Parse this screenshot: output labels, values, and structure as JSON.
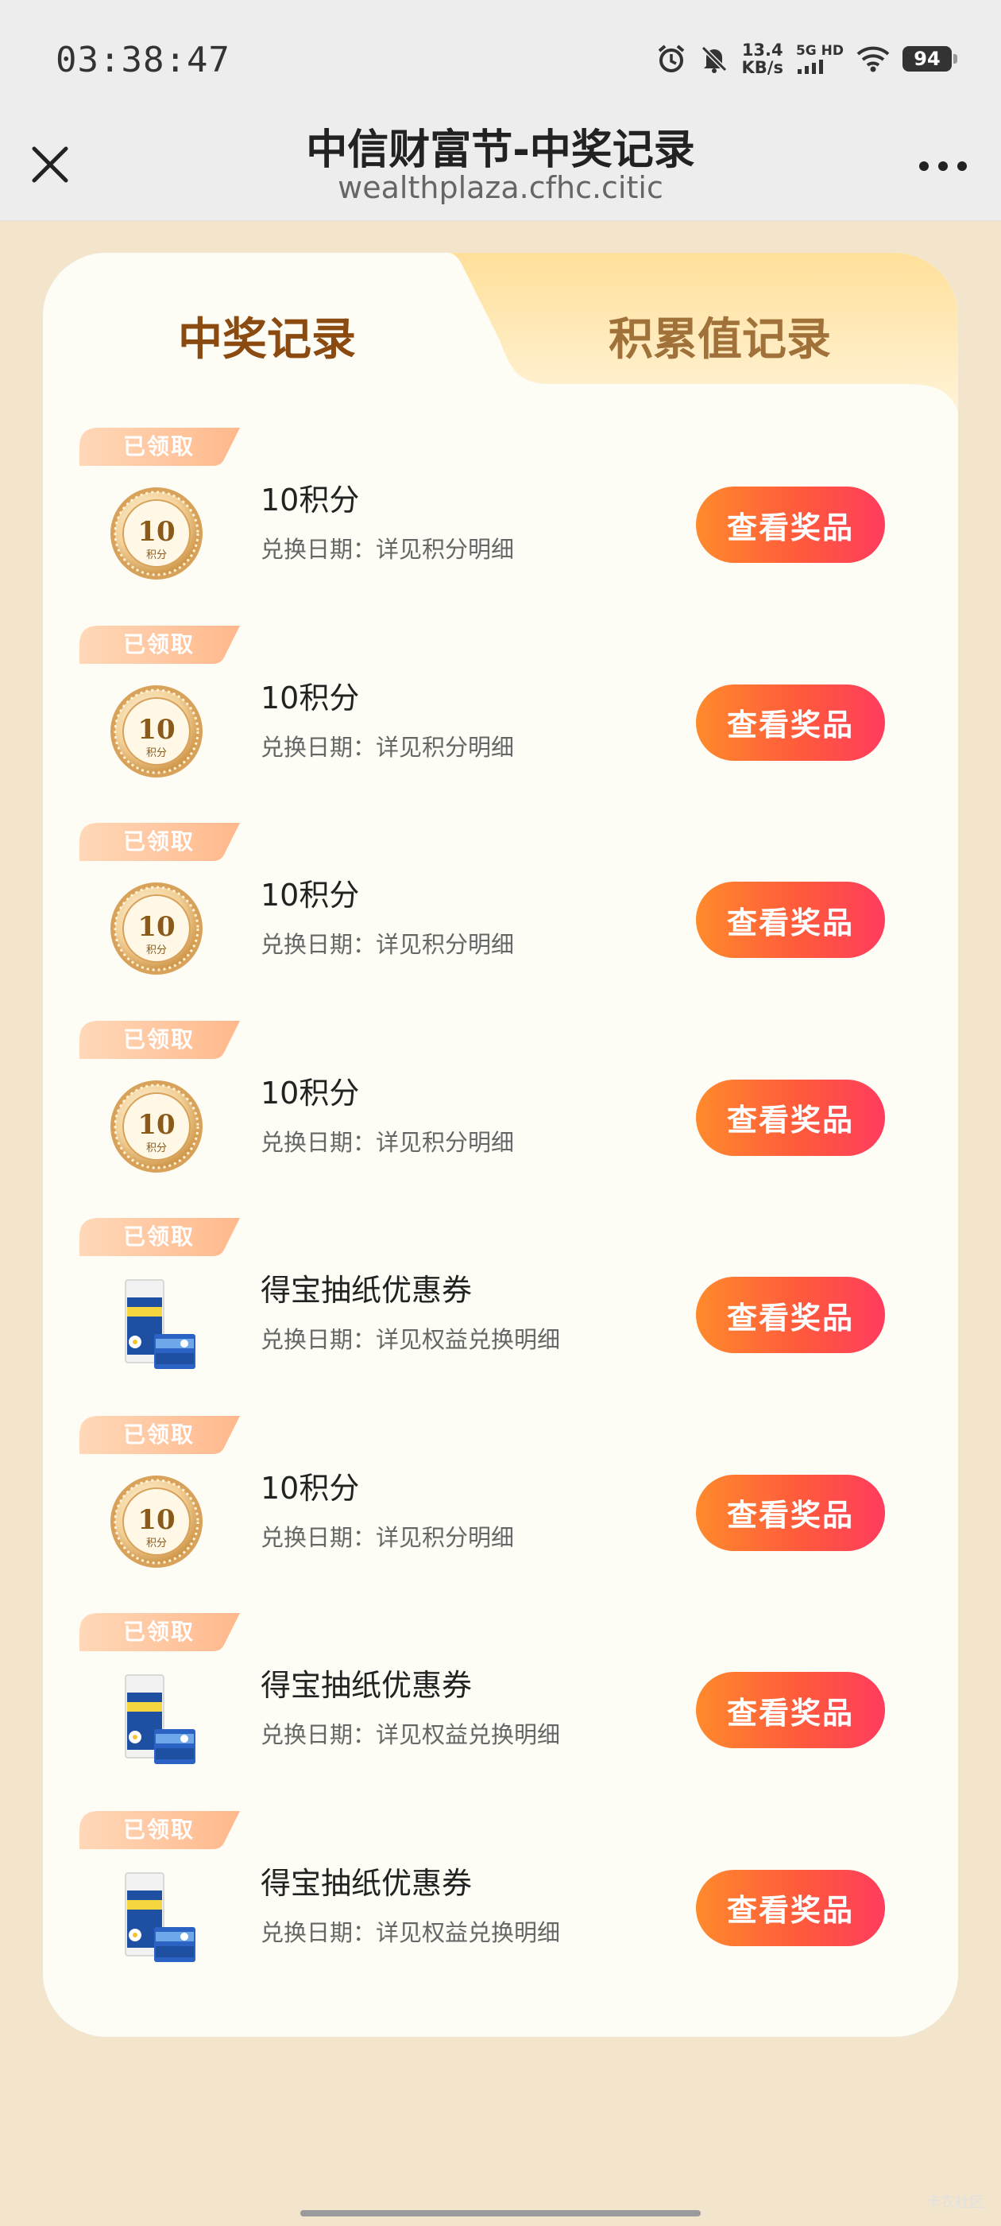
{
  "status_bar": {
    "time": "03:38:47",
    "net_speed_value": "13.4",
    "net_speed_unit": "KB/s",
    "signal_label": "5G HD",
    "battery": "94",
    "icons": [
      "alarm-icon",
      "mute-bell-icon",
      "cell-signal-icon",
      "wifi-icon",
      "battery-icon"
    ]
  },
  "header": {
    "title": "中信财富节-中奖记录",
    "url": "wealthplaza.cfhc.citic",
    "close_icon": "close-icon",
    "more_icon": "more-icon"
  },
  "tabs": [
    {
      "label": "中奖记录",
      "active": true
    },
    {
      "label": "积累值记录",
      "active": false
    }
  ],
  "records": [
    {
      "status": "已领取",
      "thumb": "coin-icon",
      "coin_value": "10",
      "coin_unit": "积分",
      "title": "10积分",
      "date": "兑换日期：详见积分明细",
      "button": "查看奖品"
    },
    {
      "status": "已领取",
      "thumb": "coin-icon",
      "coin_value": "10",
      "coin_unit": "积分",
      "title": "10积分",
      "date": "兑换日期：详见积分明细",
      "button": "查看奖品"
    },
    {
      "status": "已领取",
      "thumb": "coin-icon",
      "coin_value": "10",
      "coin_unit": "积分",
      "title": "10积分",
      "date": "兑换日期：详见积分明细",
      "button": "查看奖品"
    },
    {
      "status": "已领取",
      "thumb": "coin-icon",
      "coin_value": "10",
      "coin_unit": "积分",
      "title": "10积分",
      "date": "兑换日期：详见积分明细",
      "button": "查看奖品"
    },
    {
      "status": "已领取",
      "thumb": "tissue-pack-icon",
      "title": "得宝抽纸优惠券",
      "date": "兑换日期：详见权益兑换明细",
      "button": "查看奖品"
    },
    {
      "status": "已领取",
      "thumb": "coin-icon",
      "coin_value": "10",
      "coin_unit": "积分",
      "title": "10积分",
      "date": "兑换日期：详见积分明细",
      "button": "查看奖品"
    },
    {
      "status": "已领取",
      "thumb": "tissue-pack-icon",
      "title": "得宝抽纸优惠券",
      "date": "兑换日期：详见权益兑换明细",
      "button": "查看奖品"
    },
    {
      "status": "已领取",
      "thumb": "tissue-pack-icon",
      "title": "得宝抽纸优惠券",
      "date": "兑换日期：详见权益兑换明细",
      "button": "查看奖品"
    }
  ],
  "watermark": "卡农社区",
  "colors": {
    "page_bg": "#f3e5cc",
    "card_bg": "#fdfdf6",
    "active_tab_text": "#8a4a10",
    "inactive_tab_bg": "#ffe3a6",
    "button_gradient_start": "#ff8a2c",
    "button_gradient_end": "#ff3c5e",
    "badge": "#ffc99f"
  }
}
